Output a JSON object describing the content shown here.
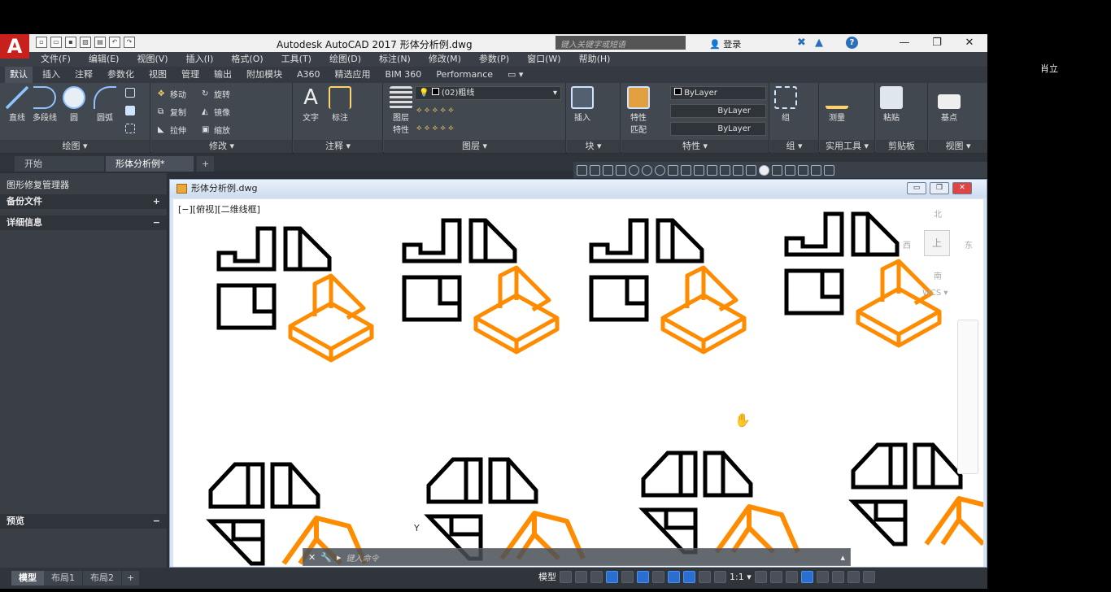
{
  "user_name": "肖立",
  "title_bar": {
    "app_logo": "A",
    "title": "Autodesk AutoCAD 2017    形体分析例.dwg",
    "search_placeholder": "键入关键字或短语",
    "login": "登录",
    "help": "?",
    "minimize": "—",
    "restore": "❐",
    "close": "✕"
  },
  "menu": [
    "文件(F)",
    "编辑(E)",
    "视图(V)",
    "插入(I)",
    "格式(O)",
    "工具(T)",
    "绘图(D)",
    "标注(N)",
    "修改(M)",
    "参数(P)",
    "窗口(W)",
    "帮助(H)"
  ],
  "ribbon_tabs": [
    "默认",
    "插入",
    "注释",
    "参数化",
    "视图",
    "管理",
    "输出",
    "附加模块",
    "A360",
    "精选应用",
    "BIM 360",
    "Performance"
  ],
  "ribbon": {
    "draw": {
      "title": "绘图 ▾",
      "line": "直线",
      "polyline": "多段线",
      "circle": "圆",
      "arc": "圆弧"
    },
    "modify": {
      "title": "修改 ▾",
      "move": "移动",
      "rotate": "旋转",
      "copy": "复制",
      "mirror": "镜像",
      "stretch": "拉伸",
      "scale": "缩放"
    },
    "annotation": {
      "title": "注释 ▾",
      "text": "文字",
      "dimension": "标注"
    },
    "layers": {
      "title": "图层 ▾",
      "layer_properties": "图层\n特性",
      "current_layer": "(02)粗线"
    },
    "block": {
      "title": "块 ▾",
      "insert": "插入"
    },
    "properties": {
      "title": "特性 ▾",
      "match": "特性\n匹配",
      "color": "ByLayer",
      "lineweight": "ByLayer",
      "linetype": "ByLayer"
    },
    "groups": {
      "title": "组 ▾",
      "group": "组"
    },
    "utilities": {
      "title": "实用工具 ▾",
      "measure": "测量"
    },
    "clipboard": {
      "title": "剪贴板",
      "paste": "粘贴"
    },
    "view": {
      "title": "视图 ▾",
      "base": "基点"
    }
  },
  "doc_tabs": {
    "start": "开始",
    "current": "形体分析例*",
    "add": "+"
  },
  "palette": {
    "drawing_recovery": "图形修复管理器",
    "backup_files": "备份文件",
    "details": "详细信息",
    "preview": "预览",
    "plus": "+",
    "minus": "−"
  },
  "drawing_window": {
    "title": "形体分析例.dwg",
    "view_label": "[−][俯视][二维线框]",
    "viewcube": {
      "north": "北",
      "south": "南",
      "west": "西",
      "east": "东",
      "top": "上",
      "wcs": "WCS ▾"
    },
    "ucs_y": "Y",
    "accent_orange": "#ff8c00",
    "ink": "#000000"
  },
  "command_line": {
    "prompt": "键入命令"
  },
  "layout_tabs": [
    "模型",
    "布局1",
    "布局2",
    "+"
  ],
  "status_bar": {
    "model": "模型",
    "scale": "1:1 ▾"
  }
}
